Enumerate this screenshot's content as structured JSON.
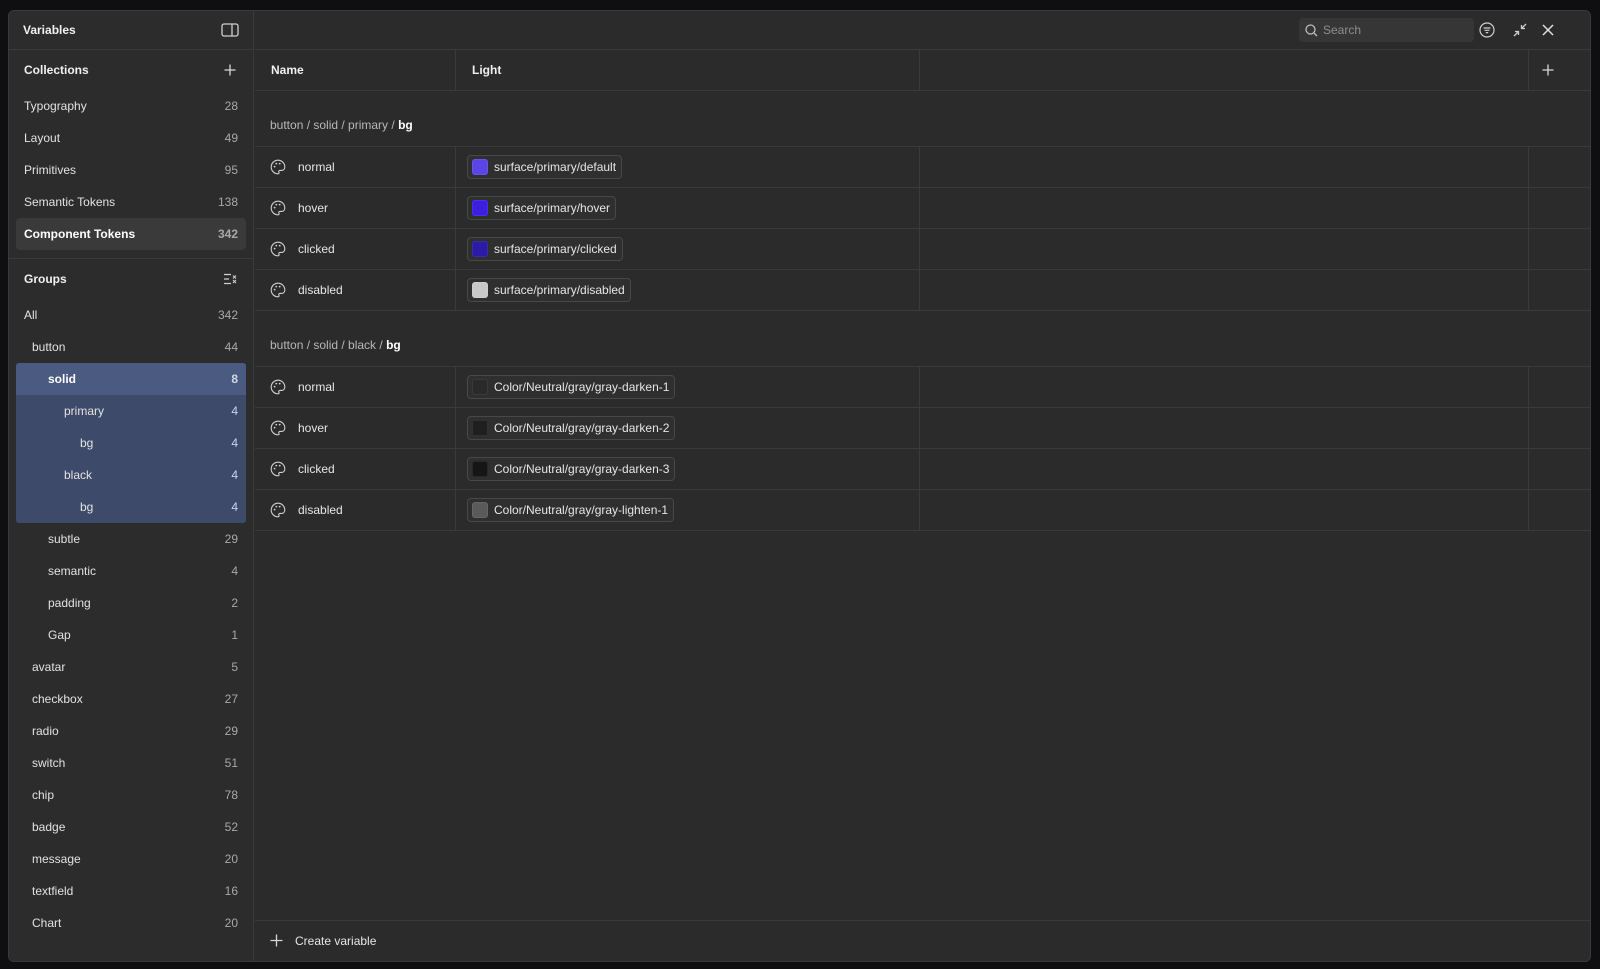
{
  "sidebar": {
    "title": "Variables",
    "collections_label": "Collections",
    "collections": [
      {
        "label": "Typography",
        "count": "28"
      },
      {
        "label": "Layout",
        "count": "49"
      },
      {
        "label": "Primitives",
        "count": "95"
      },
      {
        "label": "Semantic Tokens",
        "count": "138"
      },
      {
        "label": "Component Tokens",
        "count": "342"
      }
    ],
    "groups_label": "Groups",
    "groups": [
      {
        "label": "All",
        "count": "342"
      },
      {
        "label": "button",
        "count": "44"
      },
      {
        "label": "solid",
        "count": "8"
      },
      {
        "label": "primary",
        "count": "4"
      },
      {
        "label": "bg",
        "count": "4"
      },
      {
        "label": "black",
        "count": "4"
      },
      {
        "label": "bg",
        "count": "4"
      },
      {
        "label": "subtle",
        "count": "29"
      },
      {
        "label": "semantic",
        "count": "4"
      },
      {
        "label": "padding",
        "count": "2"
      },
      {
        "label": "Gap",
        "count": "1"
      },
      {
        "label": "avatar",
        "count": "5"
      },
      {
        "label": "checkbox",
        "count": "27"
      },
      {
        "label": "radio",
        "count": "29"
      },
      {
        "label": "switch",
        "count": "51"
      },
      {
        "label": "chip",
        "count": "78"
      },
      {
        "label": "badge",
        "count": "52"
      },
      {
        "label": "message",
        "count": "20"
      },
      {
        "label": "textfield",
        "count": "16"
      },
      {
        "label": "Chart",
        "count": "20"
      }
    ]
  },
  "search": {
    "placeholder": "Search"
  },
  "columns": {
    "name": "Name",
    "mode": "Light"
  },
  "groups": [
    {
      "path": "button / solid / primary / ",
      "leaf": "bg",
      "rows": [
        {
          "name": "normal",
          "value": "surface/primary/default",
          "color": "#5b45e6"
        },
        {
          "name": "hover",
          "value": "surface/primary/hover",
          "color": "#3a1fe0"
        },
        {
          "name": "clicked",
          "value": "surface/primary/clicked",
          "color": "#2a1aa6"
        },
        {
          "name": "disabled",
          "value": "surface/primary/disabled",
          "color": "#c8c8c8"
        }
      ]
    },
    {
      "path": "button / solid / black / ",
      "leaf": "bg",
      "rows": [
        {
          "name": "normal",
          "value": "Color/Neutral/gray/gray-darken-1",
          "color": "#2a2a2a"
        },
        {
          "name": "hover",
          "value": "Color/Neutral/gray/gray-darken-2",
          "color": "#1f1f1f"
        },
        {
          "name": "clicked",
          "value": "Color/Neutral/gray/gray-darken-3",
          "color": "#161616"
        },
        {
          "name": "disabled",
          "value": "Color/Neutral/gray/gray-lighten-1",
          "color": "#5a5a5a"
        }
      ]
    }
  ],
  "footer": {
    "create_label": "Create variable"
  }
}
